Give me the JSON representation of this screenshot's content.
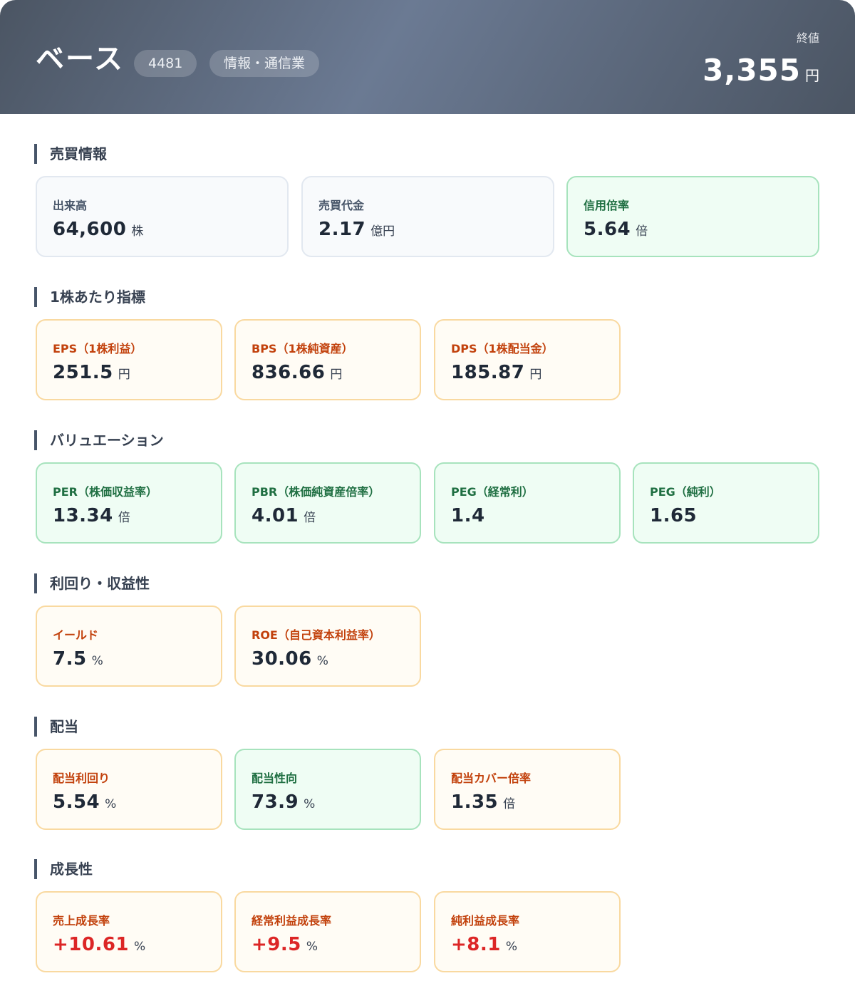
{
  "header": {
    "company_name": "ベース",
    "code": "4481",
    "sector": "情報・通信業",
    "close_label": "終値",
    "close_value": "3,355",
    "close_unit": "円"
  },
  "sections": {
    "trading": {
      "title": "売買情報",
      "volume": {
        "label": "出来高",
        "value": "64,600",
        "unit": "株"
      },
      "turnover": {
        "label": "売買代金",
        "value": "2.17",
        "unit": "億円"
      },
      "margin_ratio": {
        "label": "信用倍率",
        "value": "5.64",
        "unit": "倍"
      }
    },
    "per_share": {
      "title": "1株あたり指標",
      "eps": {
        "label": "EPS（1株利益）",
        "value": "251.5",
        "unit": "円"
      },
      "bps": {
        "label": "BPS（1株純資産）",
        "value": "836.66",
        "unit": "円"
      },
      "dps": {
        "label": "DPS（1株配当金）",
        "value": "185.87",
        "unit": "円"
      }
    },
    "valuation": {
      "title": "バリュエーション",
      "per": {
        "label": "PER（株価収益率）",
        "value": "13.34",
        "unit": "倍"
      },
      "pbr": {
        "label": "PBR（株価純資産倍率）",
        "value": "4.01",
        "unit": "倍"
      },
      "peg_ordinary": {
        "label": "PEG（経常利）",
        "value": "1.4",
        "unit": ""
      },
      "peg_net": {
        "label": "PEG（純利）",
        "value": "1.65",
        "unit": ""
      }
    },
    "yield": {
      "title": "利回り・収益性",
      "earnings_yield": {
        "label": "イールド",
        "value": "7.5",
        "unit": "%"
      },
      "roe": {
        "label": "ROE（自己資本利益率）",
        "value": "30.06",
        "unit": "%"
      }
    },
    "dividend": {
      "title": "配当",
      "dividend_yield": {
        "label": "配当利回り",
        "value": "5.54",
        "unit": "%"
      },
      "payout_ratio": {
        "label": "配当性向",
        "value": "73.9",
        "unit": "%"
      },
      "dividend_cover": {
        "label": "配当カバー倍率",
        "value": "1.35",
        "unit": "倍"
      }
    },
    "growth": {
      "title": "成長性",
      "sales_growth": {
        "label": "売上成長率",
        "value": "+10.61",
        "unit": "%"
      },
      "ordinary_growth": {
        "label": "経常利益成長率",
        "value": "+9.5",
        "unit": "%"
      },
      "net_growth": {
        "label": "純利益成長率",
        "value": "+8.1",
        "unit": "%"
      }
    }
  },
  "colors": {
    "header_bg": "#5b6579",
    "green_card_bg": "#effdf4",
    "green_card_border": "#a7e3bd",
    "orange_card_bg": "#fffcf5",
    "orange_card_border": "#f9d9a0",
    "gray_card_bg": "#f8fafc",
    "positive_growth": "#dc2626"
  }
}
